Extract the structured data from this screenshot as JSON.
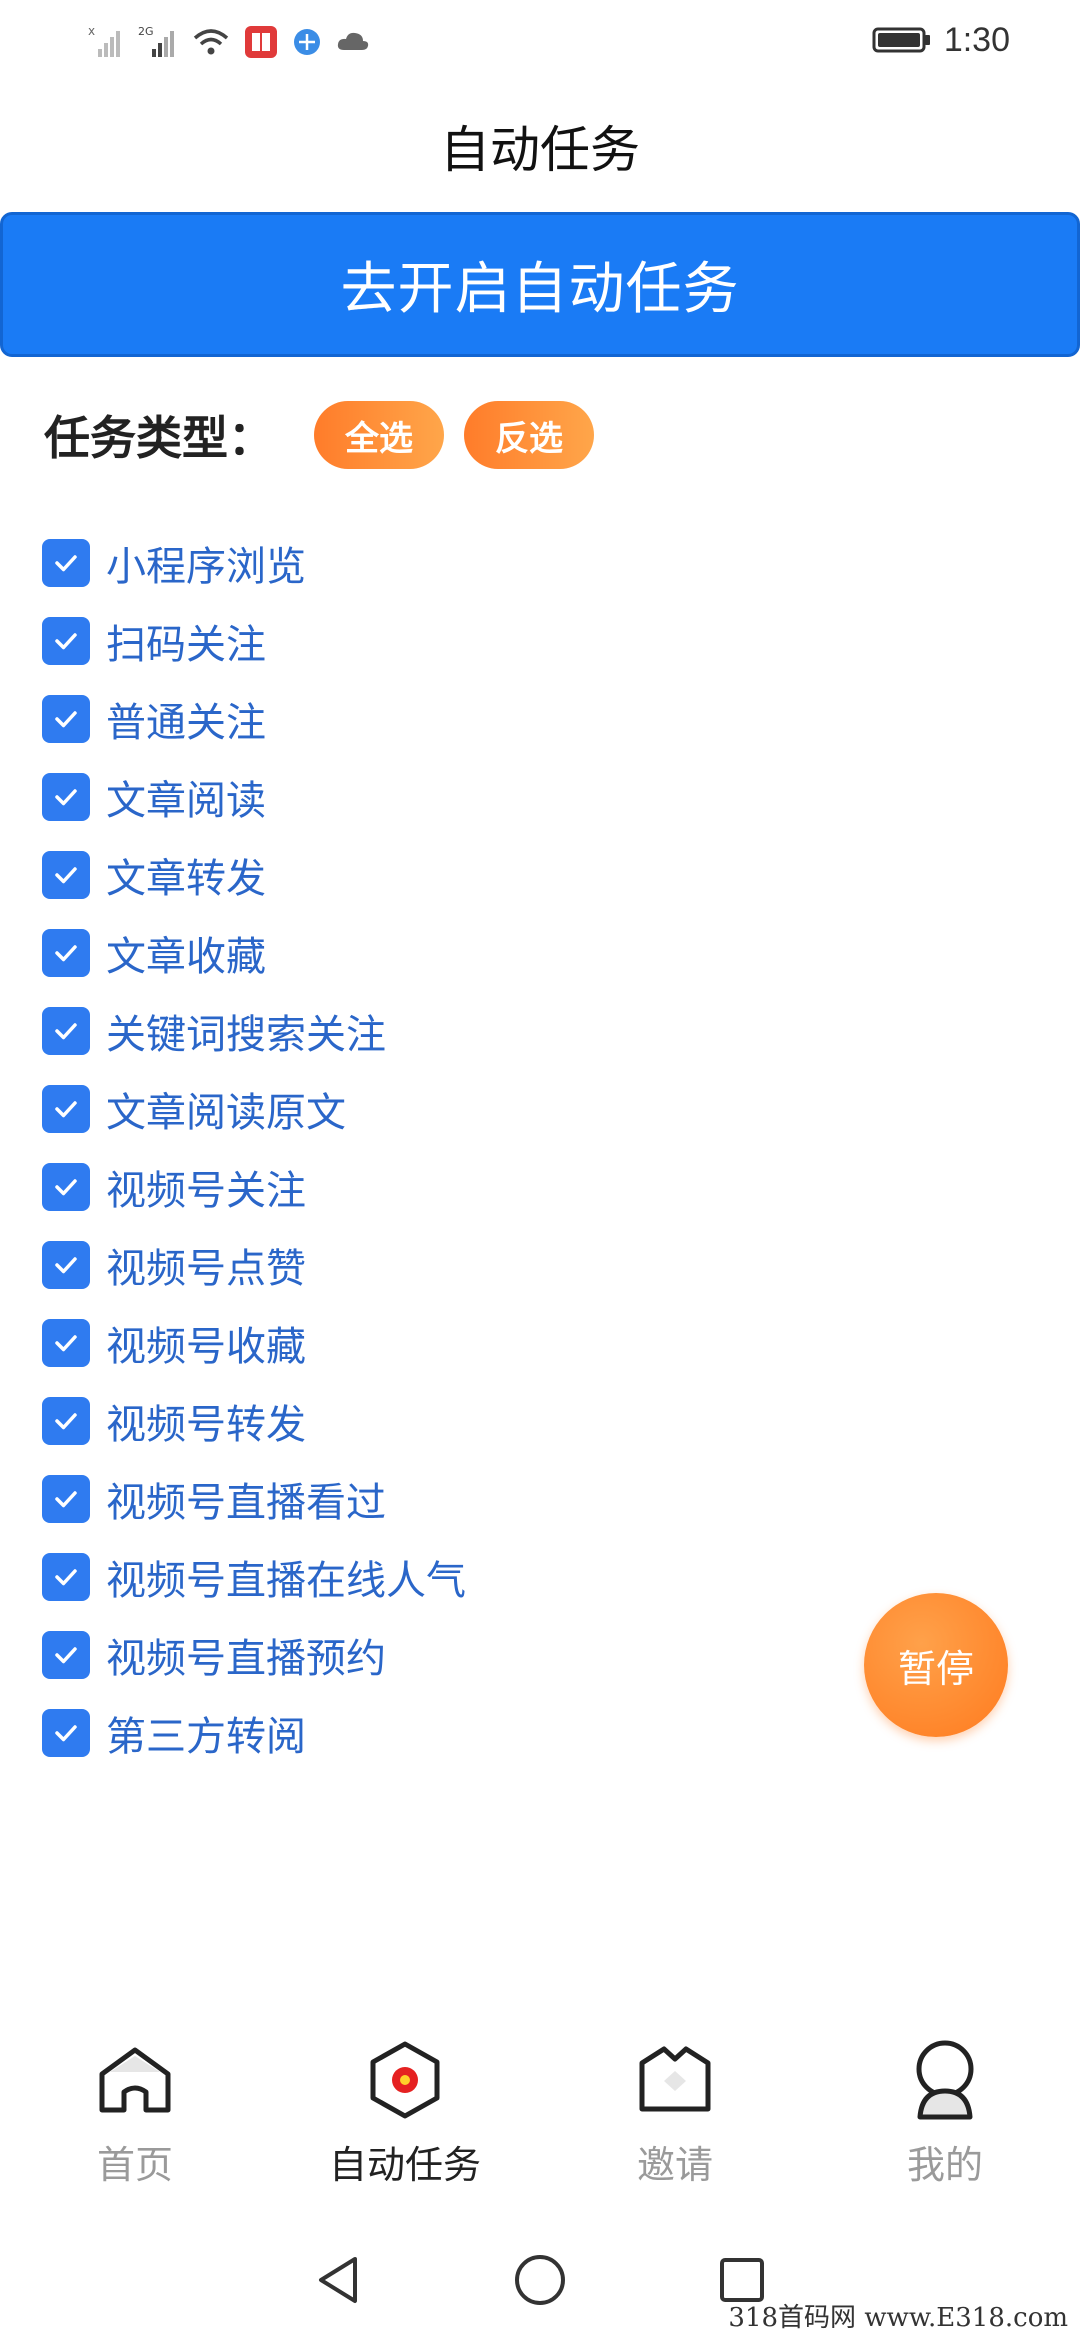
{
  "status_bar": {
    "time": "1:30"
  },
  "header": {
    "title": "自动任务"
  },
  "start_button": {
    "label": "去开启自动任务"
  },
  "task_types": {
    "label": "任务类型：",
    "select_all": "全选",
    "invert": "反选",
    "items": [
      {
        "label": "小程序浏览",
        "checked": true
      },
      {
        "label": "扫码关注",
        "checked": true
      },
      {
        "label": "普通关注",
        "checked": true
      },
      {
        "label": "文章阅读",
        "checked": true
      },
      {
        "label": "文章转发",
        "checked": true
      },
      {
        "label": "文章收藏",
        "checked": true
      },
      {
        "label": "关键词搜索关注",
        "checked": true
      },
      {
        "label": "文章阅读原文",
        "checked": true
      },
      {
        "label": "视频号关注",
        "checked": true
      },
      {
        "label": "视频号点赞",
        "checked": true
      },
      {
        "label": "视频号收藏",
        "checked": true
      },
      {
        "label": "视频号转发",
        "checked": true
      },
      {
        "label": "视频号直播看过",
        "checked": true
      },
      {
        "label": "视频号直播在线人气",
        "checked": true
      },
      {
        "label": "视频号直播预约",
        "checked": true
      },
      {
        "label": "第三方转阅",
        "checked": true
      }
    ]
  },
  "pause_button": {
    "label": "暂停"
  },
  "bottom_nav": {
    "items": [
      {
        "label": "首页",
        "icon": "home-icon"
      },
      {
        "label": "自动任务",
        "icon": "auto-task-icon",
        "active": true
      },
      {
        "label": "邀请",
        "icon": "invite-icon"
      },
      {
        "label": "我的",
        "icon": "profile-icon"
      }
    ]
  },
  "watermark": "318首码网  www.E318.com",
  "colors": {
    "primary": "#1a7bf5",
    "accent": "#ff8a2e",
    "task_text": "#2a66c9",
    "checkbox": "#2f7bf0"
  }
}
